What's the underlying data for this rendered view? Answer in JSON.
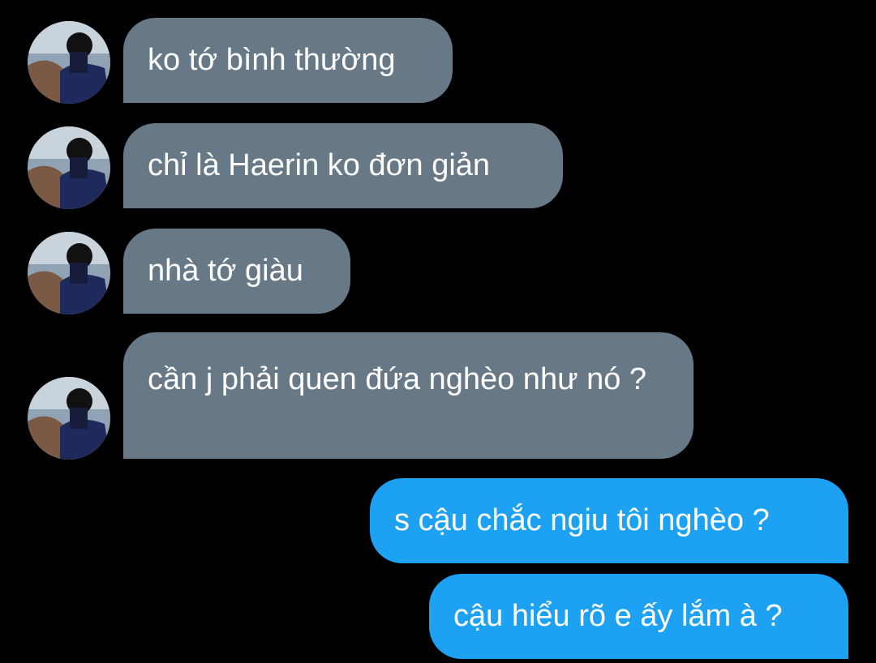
{
  "conversation": {
    "incoming": [
      {
        "text": "ko tớ bình thường"
      },
      {
        "text": "chỉ là Haerin ko đơn giản"
      },
      {
        "text": "nhà tớ giàu"
      },
      {
        "text": "cần j phải quen đứa nghèo như nó ?"
      }
    ],
    "outgoing": [
      {
        "text": "s cậu chắc ngiu tôi nghèo ?"
      },
      {
        "text": "cậu hiểu rõ e ấy lắm à ?"
      }
    ]
  },
  "colors": {
    "background": "#000000",
    "incoming_bubble": "#677887",
    "outgoing_bubble": "#1da1f2",
    "text": "#ffffff"
  },
  "icons": {
    "avatar": "user-avatar-photo"
  }
}
